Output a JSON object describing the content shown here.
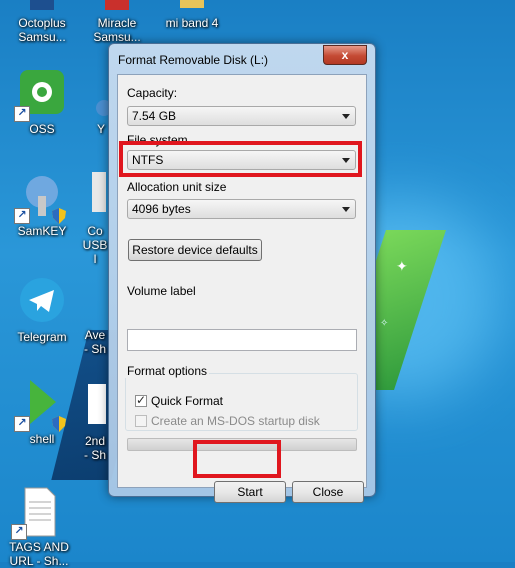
{
  "desktop": {
    "icons": [
      {
        "label": "Octoplus\nSamsu...",
        "icon": "octoplus-icon"
      },
      {
        "label": "Miracle\nSamsu...",
        "icon": "miracle-icon"
      },
      {
        "label": "mi band 4",
        "icon": "folder-icon"
      },
      {
        "label": "OSS",
        "icon": "oss-icon"
      },
      {
        "label": "Y",
        "icon": "app-icon"
      },
      {
        "label": "SamKEY",
        "icon": "samkey-icon"
      },
      {
        "label": "Co\nUSB I",
        "icon": "usb-icon"
      },
      {
        "label": "Telegram",
        "icon": "telegram-icon"
      },
      {
        "label": "Ave\n- Sh",
        "icon": "shortcut-icon"
      },
      {
        "label": "shell",
        "icon": "shell-icon"
      },
      {
        "label": "2nd\n- Sh",
        "icon": "document-icon"
      },
      {
        "label": "TAGS AND\nURL - Sh...",
        "icon": "text-file-icon"
      }
    ]
  },
  "dialog": {
    "title": "Format Removable Disk (L:)",
    "close_label": "x",
    "capacity_label": "Capacity:",
    "capacity_value": "7.54 GB",
    "filesystem_label": "File system",
    "filesystem_value": "NTFS",
    "allocation_label": "Allocation unit size",
    "allocation_value": "4096 bytes",
    "restore_label": "Restore device defaults",
    "volume_label": "Volume label",
    "volume_value": "",
    "format_options_label": "Format options",
    "quick_format_label": "Quick Format",
    "quick_format_checked": true,
    "msdos_label": "Create an MS-DOS startup disk",
    "msdos_checked": false,
    "msdos_enabled": false,
    "progress": 0,
    "start_label": "Start",
    "close_button_label": "Close"
  },
  "colors": {
    "highlight": "#e0161e",
    "desktop": "#1a7fc4"
  }
}
